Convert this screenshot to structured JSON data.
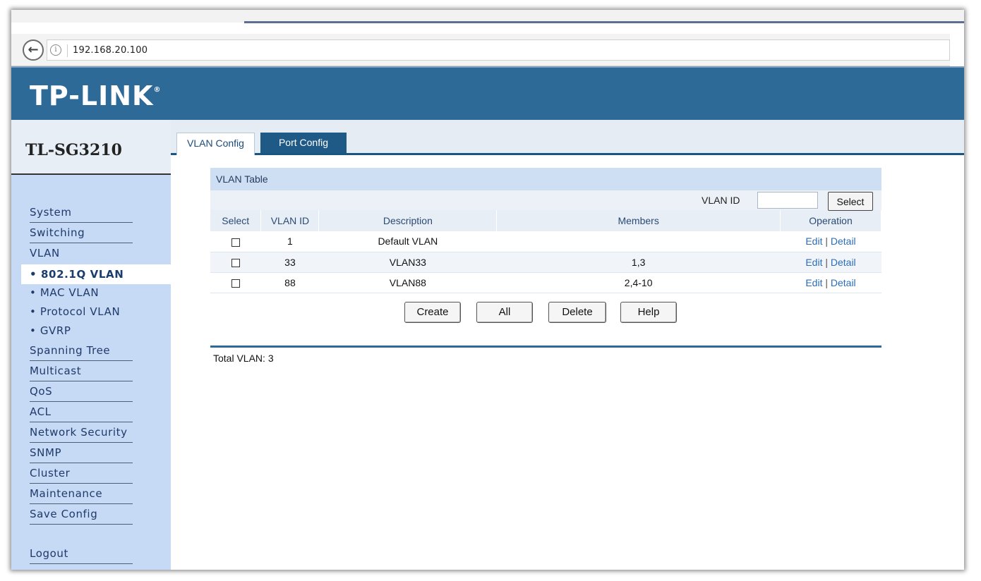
{
  "browser": {
    "url": "192.168.20.100",
    "back_icon": "arrow-left-icon",
    "info_icon": "info-icon"
  },
  "header": {
    "logo": "TP-LINK",
    "logo_mark": "®",
    "model": "TL-SG3210",
    "brand_color": "#2e6a97"
  },
  "tabs": [
    {
      "label": "VLAN Config",
      "active": true
    },
    {
      "label": "Port Config",
      "active": false
    }
  ],
  "sidebar": {
    "items": [
      {
        "label": "System"
      },
      {
        "label": "Switching"
      },
      {
        "label": "VLAN"
      },
      {
        "label": "• 802.1Q VLAN",
        "selected": true
      },
      {
        "label": "• MAC VLAN"
      },
      {
        "label": "• Protocol VLAN"
      },
      {
        "label": "• GVRP"
      },
      {
        "label": "Spanning Tree"
      },
      {
        "label": "Multicast"
      },
      {
        "label": "QoS"
      },
      {
        "label": "ACL"
      },
      {
        "label": "Network Security"
      },
      {
        "label": "SNMP"
      },
      {
        "label": "Cluster"
      },
      {
        "label": "Maintenance"
      },
      {
        "label": "Save Config"
      },
      {
        "label": "Logout"
      }
    ]
  },
  "vlan_table": {
    "title": "VLAN Table",
    "search_label": "VLAN ID",
    "search_value": "",
    "select_button": "Select",
    "columns": [
      "Select",
      "VLAN ID",
      "Description",
      "Members",
      "Operation"
    ],
    "rows": [
      {
        "vlan_id": "1",
        "description": "Default VLAN",
        "members": "",
        "edit": "Edit",
        "sep": "|",
        "detail": "Detail"
      },
      {
        "vlan_id": "33",
        "description": "VLAN33",
        "members": "1,3",
        "edit": "Edit",
        "sep": "|",
        "detail": "Detail"
      },
      {
        "vlan_id": "88",
        "description": "VLAN88",
        "members": "2,4-10",
        "edit": "Edit",
        "sep": "|",
        "detail": "Detail"
      }
    ],
    "buttons": {
      "create": "Create",
      "all": "All",
      "delete": "Delete",
      "help": "Help"
    },
    "total": "Total VLAN: 3"
  }
}
